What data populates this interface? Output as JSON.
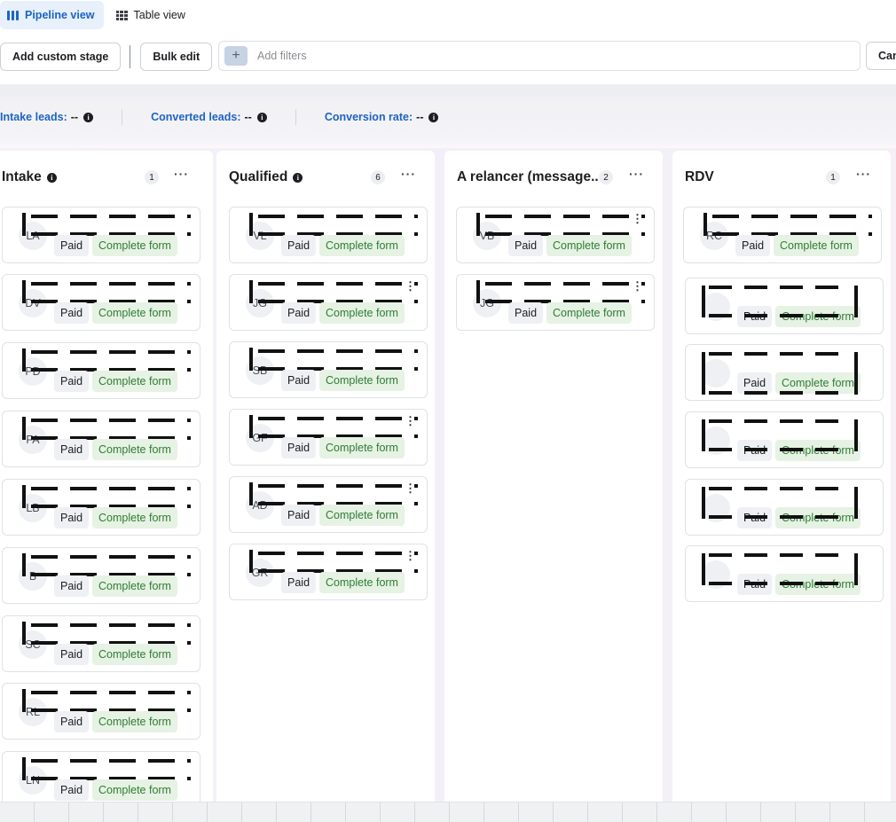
{
  "views": {
    "pipeline": "Pipeline view",
    "table": "Table view"
  },
  "toolbar": {
    "add_stage": "Add custom stage",
    "bulk_edit": "Bulk edit",
    "filters_placeholder": "Add filters",
    "cut_button": "Can"
  },
  "stats": {
    "intake_label": "Intake leads:",
    "intake_value": "--",
    "converted_label": "Converted leads:",
    "converted_value": "--",
    "rate_label": "Conversion rate:",
    "rate_value": "--"
  },
  "tags": {
    "paid": "Paid",
    "form": "Complete form"
  },
  "columns": [
    {
      "title": "Intake",
      "count": "1",
      "cards": [
        "LA",
        "DV",
        "PD",
        "FA",
        "LB",
        "B",
        "SC",
        "RL",
        "LN"
      ]
    },
    {
      "title": "Qualified",
      "count": "6",
      "cards": [
        "VL",
        "JG",
        "SB",
        "GF",
        "AD",
        "GR"
      ]
    },
    {
      "title": "A relancer (message...",
      "count": "2",
      "cards": [
        "VB",
        "JG"
      ]
    },
    {
      "title": "RDV",
      "count": "1",
      "cards": [
        "RC",
        "",
        "",
        "",
        "",
        ""
      ]
    }
  ]
}
